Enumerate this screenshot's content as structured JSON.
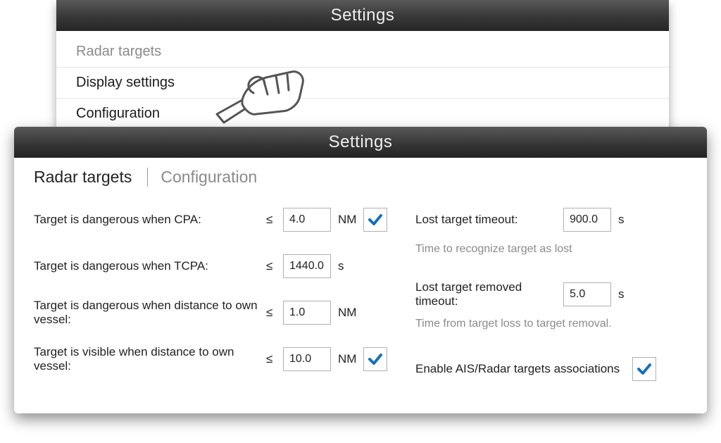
{
  "top": {
    "title": "Settings",
    "section": "Radar targets",
    "items": [
      {
        "label": "Display settings"
      },
      {
        "label": "Configuration"
      }
    ]
  },
  "bottom": {
    "title": "Settings",
    "breadcrumb": {
      "main": "Radar targets",
      "sub": "Configuration"
    },
    "left": {
      "cpa": {
        "label": "Target is dangerous when CPA:",
        "op": "≤",
        "value": "4.0",
        "unit": "NM",
        "checked": true
      },
      "tcpa": {
        "label": "Target is dangerous when TCPA:",
        "op": "≤",
        "value": "1440.0",
        "unit": "s"
      },
      "distDang": {
        "label": "Target is dangerous when distance to own vessel:",
        "op": "≤",
        "value": "1.0",
        "unit": "NM"
      },
      "distVis": {
        "label": "Target is visible when distance to own vessel:",
        "op": "≤",
        "value": "10.0",
        "unit": "NM",
        "checked": true
      }
    },
    "right": {
      "lostTimeout": {
        "label": "Lost target timeout:",
        "value": "900.0",
        "unit": "s"
      },
      "lostHint": "Time to recognize target as lost",
      "removed": {
        "label": "Lost target removed timeout:",
        "value": "5.0",
        "unit": "s"
      },
      "removedHint": "Time from target loss to target removal.",
      "assoc": {
        "label": "Enable AIS/Radar targets associations",
        "checked": true
      }
    }
  }
}
